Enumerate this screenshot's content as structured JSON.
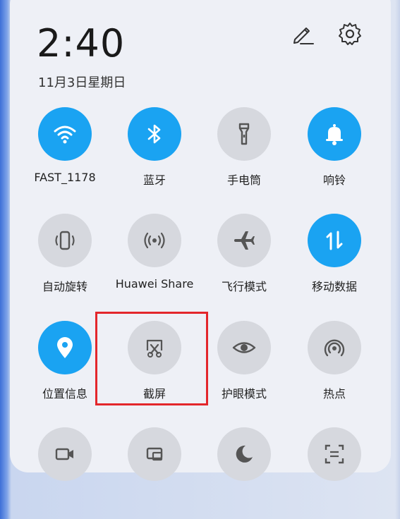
{
  "header": {
    "time": "2:40",
    "date": "11月3日星期日"
  },
  "tiles": [
    {
      "label": "FAST_1178",
      "icon": "wifi-icon",
      "active": true
    },
    {
      "label": "蓝牙",
      "icon": "bluetooth-icon",
      "active": true
    },
    {
      "label": "手电筒",
      "icon": "flashlight-icon",
      "active": false
    },
    {
      "label": "响铃",
      "icon": "bell-icon",
      "active": true
    },
    {
      "label": "自动旋转",
      "icon": "auto-rotate-icon",
      "active": false
    },
    {
      "label": "Huawei Share",
      "icon": "huawei-share-icon",
      "active": false
    },
    {
      "label": "飞行模式",
      "icon": "airplane-icon",
      "active": false
    },
    {
      "label": "移动数据",
      "icon": "mobile-data-icon",
      "active": true
    },
    {
      "label": "位置信息",
      "icon": "location-icon",
      "active": true
    },
    {
      "label": "截屏",
      "icon": "screenshot-icon",
      "active": false
    },
    {
      "label": "护眼模式",
      "icon": "eye-comfort-icon",
      "active": false
    },
    {
      "label": "热点",
      "icon": "hotspot-icon",
      "active": false
    }
  ],
  "colors": {
    "active": "#1aa3f2",
    "inactive": "#d6d8de",
    "highlight": "#e3262b"
  }
}
